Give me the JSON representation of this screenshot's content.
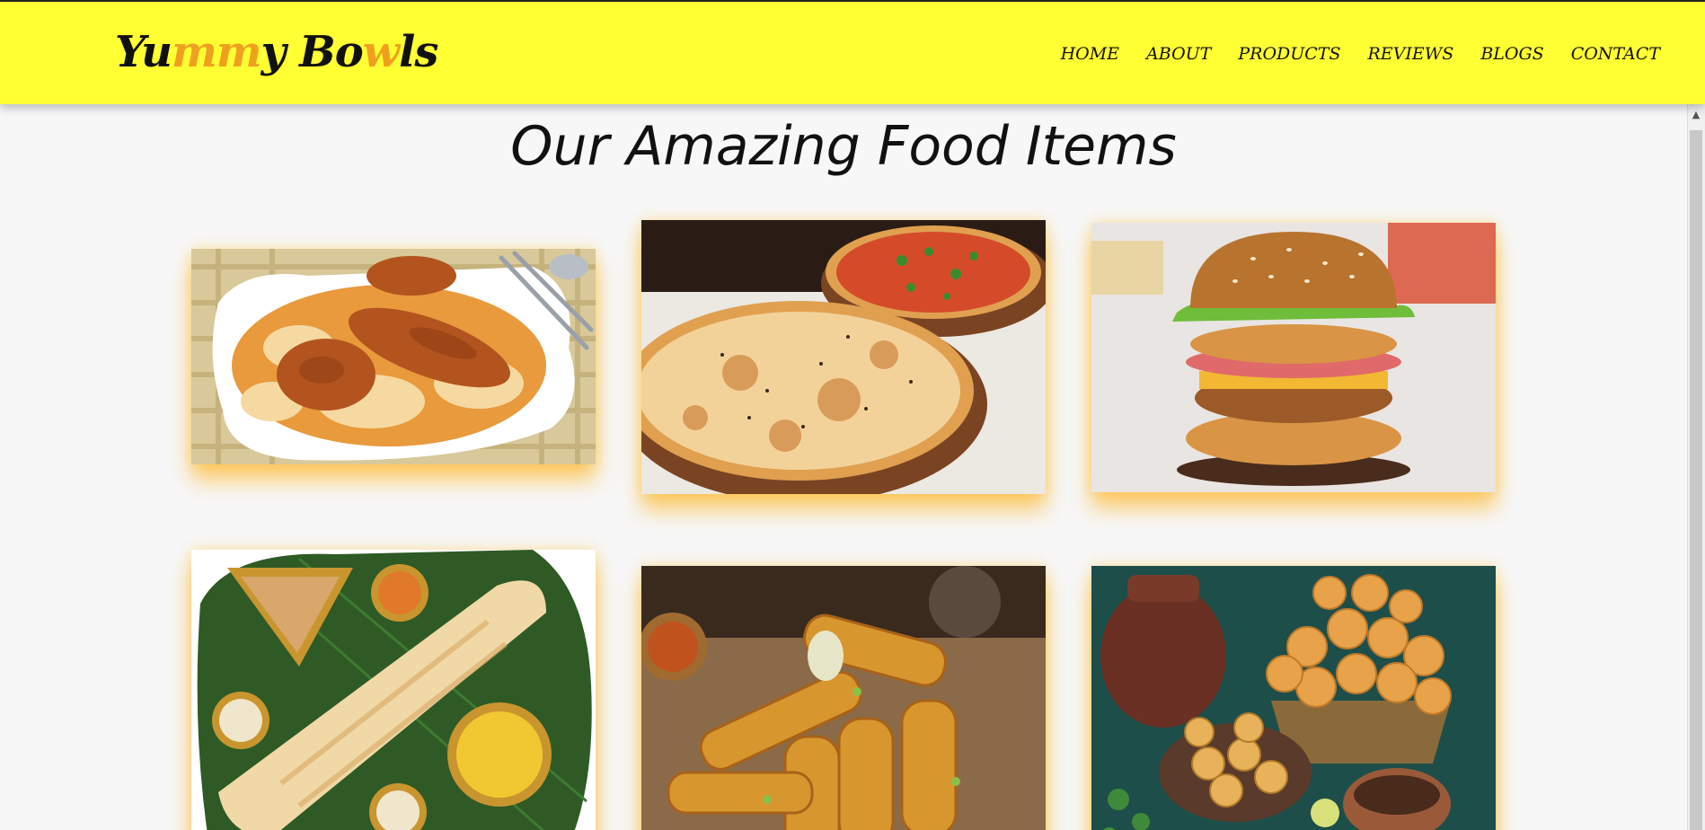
{
  "logo": {
    "part1": "Yu",
    "part2": "mm",
    "part3": "y Bo",
    "part4": "w",
    "part5": "ls"
  },
  "nav": {
    "home": "HOME",
    "about": "ABOUT",
    "products": "PRODUCTS",
    "reviews": "REVIEWS",
    "blogs": "BLOGS",
    "contact": "CONTACT"
  },
  "page_title": "Our Amazing Food Items",
  "colors": {
    "header": "#ffff33",
    "accent": "#f0a020",
    "glow": "#ffaa00"
  },
  "items": [
    {
      "icon": "biryani-image"
    },
    {
      "icon": "pizza-image"
    },
    {
      "icon": "burger-image"
    },
    {
      "icon": "dosa-image"
    },
    {
      "icon": "spring-rolls-image"
    },
    {
      "icon": "pani-puri-image"
    }
  ]
}
